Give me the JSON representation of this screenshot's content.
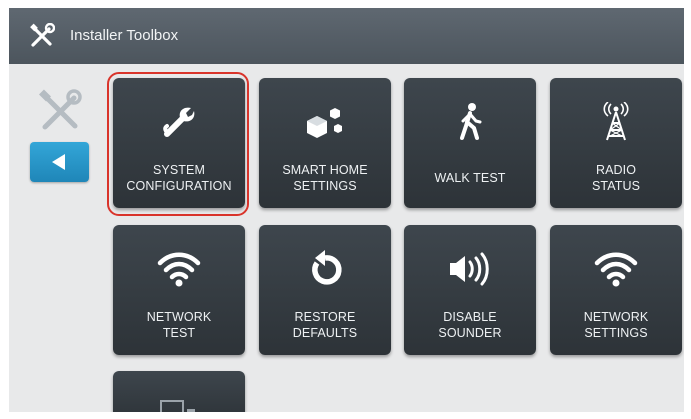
{
  "header": {
    "title": "Installer Toolbox",
    "icon": "tools-icon"
  },
  "sidebar": {
    "tools_icon": "tools-icon",
    "back_icon": "chevron-left-icon"
  },
  "tiles": [
    {
      "label": "SYSTEM\nCONFIGURATION",
      "icon": "wrench-icon",
      "selected": true
    },
    {
      "label": "SMART HOME\nSETTINGS",
      "icon": "smart-home-cubes-icon"
    },
    {
      "label": "WALK TEST",
      "icon": "walking-person-icon"
    },
    {
      "label": "RADIO\nSTATUS",
      "icon": "radio-tower-icon"
    },
    {
      "label": "NETWORK\nTEST",
      "icon": "wifi-icon"
    },
    {
      "label": "RESTORE\nDEFAULTS",
      "icon": "restore-icon"
    },
    {
      "label": "DISABLE\nSOUNDER",
      "icon": "speaker-icon"
    },
    {
      "label": "NETWORK\nSETTINGS",
      "icon": "wifi-icon"
    }
  ],
  "colors": {
    "titlebar": "#555e66",
    "tile": "#353c42",
    "accent": "#2a98cc",
    "selection": "#d9342b"
  }
}
